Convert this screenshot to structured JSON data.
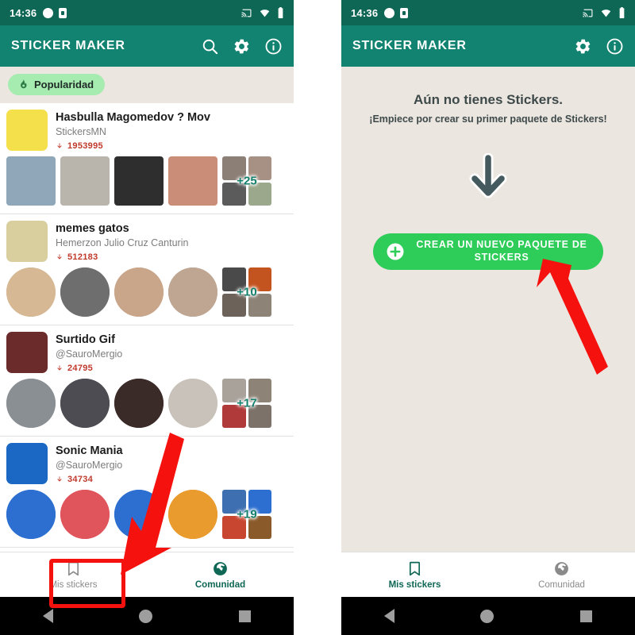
{
  "statusbar": {
    "time": "14:36",
    "icons": [
      "dot-icon",
      "lock-icon",
      "cast-icon",
      "wifi-icon",
      "battery-icon"
    ]
  },
  "colors": {
    "status_bar": "#0E6655",
    "app_bar": "#128370",
    "background": "#ECE6E1",
    "chip": "#A6EBB0",
    "accent_green": "#2ECC58",
    "download_red": "#C0392B",
    "annotation_red": "#F5110E",
    "nav_active": "#0E6655"
  },
  "left_screen": {
    "appbar": {
      "title": "STICKER MAKER",
      "actions": [
        {
          "name": "search-icon",
          "label": "Buscar"
        },
        {
          "name": "gear-icon",
          "label": "Ajustes"
        },
        {
          "name": "info-icon",
          "label": "Información"
        }
      ]
    },
    "filter_chip": {
      "label": "Popularidad",
      "icon": "fire-icon"
    },
    "packs": [
      {
        "title": "Hasbulla Magomedov ? Mov",
        "author": "StickersMN",
        "downloads": "1953995",
        "more_count": "+25",
        "avatar_color": "#F4E04B",
        "thumbs": [
          "#8FA7B8",
          "#B9B4AC",
          "#2E2E2E",
          "#C98D78"
        ],
        "minis": [
          "#8C7F76",
          "#A79184",
          "#5B5B5B",
          "#9CA88B"
        ]
      },
      {
        "title": "memes gatos",
        "author": "Hemerzon Julio Cruz Canturin",
        "downloads": "512183",
        "more_count": "+10",
        "avatar_color": "#D8CE9E",
        "thumbs": [
          "#D6B894",
          "#6E6E6E",
          "#C9A58A",
          "#BFA693"
        ],
        "minis": [
          "#4A4A4A",
          "#C4541F",
          "#6D6259",
          "#8E8377"
        ]
      },
      {
        "title": "Surtido Gif",
        "author": "@SauroMergio",
        "downloads": "24795",
        "more_count": "+17",
        "avatar_color": "#6B2B2B",
        "thumbs": [
          "#8A8F93",
          "#4C4C52",
          "#3A2A28",
          "#C9C2BA"
        ],
        "minis": [
          "#A9A29B",
          "#8D8377",
          "#B03A3A",
          "#7C7269"
        ]
      },
      {
        "title": "Sonic Mania",
        "author": "@SauroMergio",
        "downloads": "34734",
        "more_count": "+19",
        "avatar_color": "#1B68C4",
        "thumbs": [
          "#2C6FD1",
          "#E0545C",
          "#2C6FD1",
          "#E99B2E"
        ],
        "minis": [
          "#3E6FB0",
          "#2C6FD1",
          "#C8452F",
          "#8A5A2B"
        ]
      }
    ],
    "bottom_nav": [
      {
        "label": "Mis stickers",
        "icon": "bookmark-icon",
        "active": false
      },
      {
        "label": "Comunidad",
        "icon": "globe-icon",
        "active": true
      }
    ]
  },
  "right_screen": {
    "appbar": {
      "title": "STICKER MAKER",
      "actions": [
        {
          "name": "gear-icon",
          "label": "Ajustes"
        },
        {
          "name": "info-icon",
          "label": "Información"
        }
      ]
    },
    "empty_state": {
      "title": "Aún no tienes Stickers.",
      "subtitle": "¡Empiece por crear su primer paquete de Stickers!",
      "arrow_icon": "arrow-down-icon",
      "cta_label": "CREAR UN NUEVO PAQUETE DE STICKERS",
      "cta_icon": "plus-circle-icon"
    },
    "bottom_nav": [
      {
        "label": "Mis stickers",
        "icon": "bookmark-icon",
        "active": true
      },
      {
        "label": "Comunidad",
        "icon": "globe-icon",
        "active": false
      }
    ]
  },
  "annotations": {
    "highlight_box": {
      "target": "Mis stickers"
    },
    "arrow_left": {
      "points_to": "Mis stickers tab"
    },
    "arrow_right": {
      "points_to": "CREAR UN NUEVO PAQUETE DE STICKERS button"
    }
  }
}
